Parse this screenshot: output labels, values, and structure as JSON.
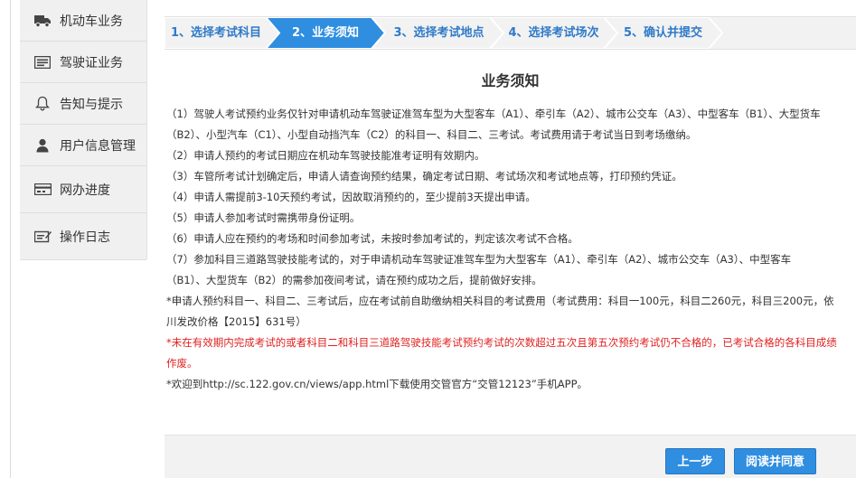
{
  "sidebar": {
    "items": [
      {
        "label": "机动车业务",
        "icon": "truck-icon"
      },
      {
        "label": "驾驶证业务",
        "icon": "license-card-icon"
      },
      {
        "label": "告知与提示",
        "icon": "bell-icon"
      },
      {
        "label": "用户信息管理",
        "icon": "user-icon"
      },
      {
        "label": "网办进度",
        "icon": "progress-card-icon"
      },
      {
        "label": "操作日志",
        "icon": "log-icon"
      }
    ]
  },
  "steps": [
    {
      "label": "1、选择考试科目",
      "active": false
    },
    {
      "label": "2、业务须知",
      "active": true
    },
    {
      "label": "3、选择考试地点",
      "active": false
    },
    {
      "label": "4、选择考试场次",
      "active": false
    },
    {
      "label": "5、确认并提交",
      "active": false
    }
  ],
  "colors": {
    "accent": "#2f8ee0",
    "step_active": "#2f8ee0",
    "step_text": "#2f7ac8",
    "warning": "#e02020"
  },
  "notice": {
    "title": "业务须知",
    "lines": [
      {
        "text": "（1）驾驶人考试预约业务仅针对申请机动车驾驶证准驾车型为大型客车（A1）、牵引车（A2）、城市公交车（A3）、中型客车（B1）、大型货车",
        "red": false
      },
      {
        "text": "（B2）、小型汽车（C1）、小型自动挡汽车（C2）的科目一、科目二、三考试。考试费用请于考试当日到考场缴纳。",
        "red": false
      },
      {
        "text": "（2）申请人预约的考试日期应在机动车驾驶技能准考证明有效期内。",
        "red": false
      },
      {
        "text": "（3）车管所考试计划确定后，申请人请查询预约结果，确定考试日期、考试场次和考试地点等，打印预约凭证。",
        "red": false
      },
      {
        "text": "（4）申请人需提前3-10天预约考试，因故取消预约的，至少提前3天提出申请。",
        "red": false
      },
      {
        "text": "（5）申请人参加考试时需携带身份证明。",
        "red": false
      },
      {
        "text": "（6）申请人应在预约的考场和时间参加考试，未按时参加考试的，判定该次考试不合格。",
        "red": false
      },
      {
        "text": "（7）参加科目三道路驾驶技能考试的，对于申请机动车驾驶证准驾车型为大型客车（A1）、牵引车（A2）、城市公交车（A3）、中型客车",
        "red": false
      },
      {
        "text": "（B1）、大型货车（B2）的需参加夜间考试，请在预约成功之后，提前做好安排。",
        "red": false
      },
      {
        "text": "*申请人预约科目一、科目二、三考试后，应在考试前自助缴纳相关科目的考试费用（考试费用：科目一100元，科目二260元，科目三200元，依",
        "red": false
      },
      {
        "text": "川发改价格【2015】631号）",
        "red": false
      },
      {
        "text": "*未在有效期内完成考试的或者科目二和科目三道路驾驶技能考试预约考试的次数超过五次且第五次预约考试仍不合格的，已考试合格的各科目成绩",
        "red": true
      },
      {
        "text": "作废。",
        "red": true
      },
      {
        "text": "*欢迎到http://sc.122.gov.cn/views/app.html下载使用交管官方“交管12123”手机APP。",
        "red": false
      }
    ]
  },
  "footer": {
    "prev_label": "上一步",
    "agree_label": "阅读并同意"
  }
}
